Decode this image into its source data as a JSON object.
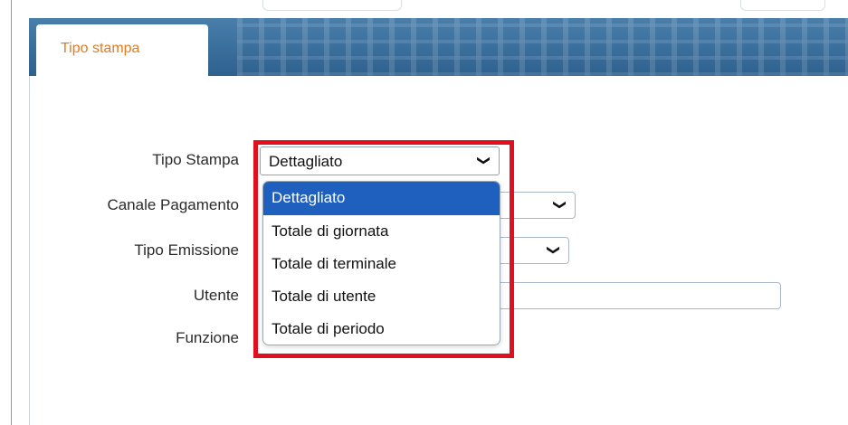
{
  "tab": {
    "label": "Tipo stampa"
  },
  "form": {
    "tipo_stampa_label": "Tipo Stampa",
    "canale_pagamento_label": "Canale Pagamento",
    "tipo_emissione_label": "Tipo Emissione",
    "utente_label": "Utente",
    "funzione_label": "Funzione",
    "tipo_stampa_value": "Dettagliato"
  },
  "dropdown": {
    "options": [
      "Dettagliato",
      "Totale di giornata",
      "Totale di terminale",
      "Totale di utente",
      "Totale di periodo"
    ],
    "selected_index": 0
  },
  "icons": {
    "chevron": "chevron-down-icon"
  },
  "colors": {
    "tab_label": "#e87a1e",
    "header_bg": "#3b6f9c",
    "selected_option_bg": "#1f5fbd",
    "highlight_border": "#e0101e"
  }
}
